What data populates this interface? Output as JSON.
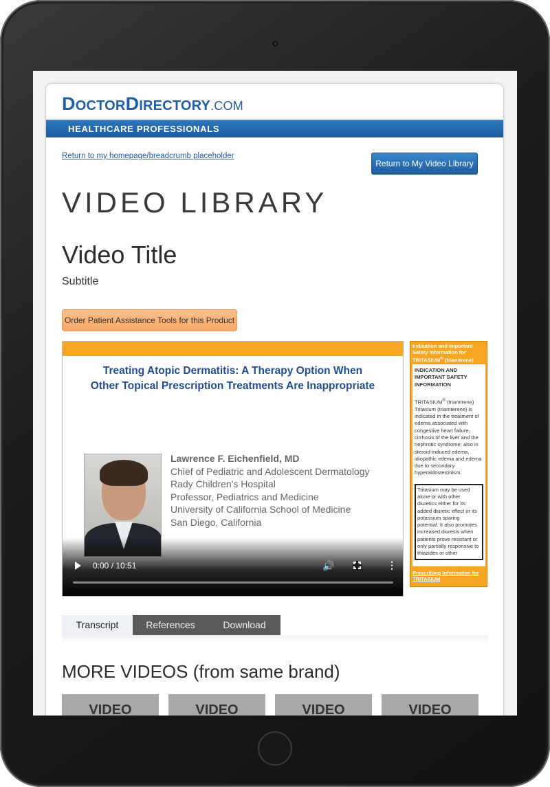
{
  "brand": {
    "logo_part1": "D",
    "logo_part2": "OCTOR",
    "logo_part3": "D",
    "logo_part4": "IRECTORY",
    "logo_tld": ".COM",
    "banner": "HEALTHCARE PROFESSIONALS",
    "primary_color": "#1f5fa8",
    "accent_color": "#f6a623"
  },
  "nav": {
    "breadcrumb": "Return to my homepage/breadcrumb placeholder",
    "return_button": "Return to My Video Library"
  },
  "page": {
    "section_title": "VIDEO LIBRARY",
    "video_title": "Video Title",
    "subtitle": "Subtitle",
    "order_button": "Order Patient Assistance Tools for this Product"
  },
  "player": {
    "headline_line1": "Treating Atopic Dermatitis: A Therapy Option When",
    "headline_line2": "Other Topical Prescription Treatments Are Inappropriate",
    "speaker_name": "Lawrence F. Eichenfield, MD",
    "speaker_lines": [
      "Chief of Pediatric and Adolescent Dermatology",
      "Rady Children's Hospital",
      "Professor, Pediatrics and Medicine",
      "University of California School of Medicine",
      "San Diego, California"
    ],
    "timecode": "0:00 / 10:51",
    "progress": 0,
    "icons": [
      "play-icon",
      "volume-icon",
      "fullscreen-icon",
      "more-options-icon"
    ]
  },
  "isi": {
    "header_line1": "Indication and Important",
    "header_line2": "Safety Information for",
    "header_line3": "TRITASIUM",
    "header_reg": "®",
    "header_line3b": " (triamtrene)",
    "sub_heading_1": "INDICATION AND",
    "sub_heading_2": "IMPORTANT SAFETY",
    "sub_heading_3": "INFORMATION",
    "body_brand": "TRITASIUM",
    "body_reg": "®",
    "body_brand_suffix": " (triamtrene)",
    "body_text": "Tritasium (triamterene) is indicated in the treatment of edema associated with congestive heart failure, cirrhosis of the liver and the nephrotic syndrome; also in steroid-induced edema, idiopathic edema and edema due to secondary hyperaldosteronism.",
    "box_text": "Tritasium may be used alone or with other diuretics either for its added diuretic effect or its potassium sparing potential. It also promotes increased diuresis when patients prove resistant or only partially responsive to thiazides or other",
    "link_line1": "Prescribing Information for",
    "link_line2": "TRITASIUM"
  },
  "tabs": [
    {
      "label": "Transcript",
      "active": true
    },
    {
      "label": "References",
      "active": false
    },
    {
      "label": "Download",
      "active": false
    }
  ],
  "more_videos": {
    "heading": "MORE VIDEOS (from same brand)",
    "thumbs": [
      "VIDEO",
      "VIDEO",
      "VIDEO",
      "VIDEO"
    ]
  }
}
